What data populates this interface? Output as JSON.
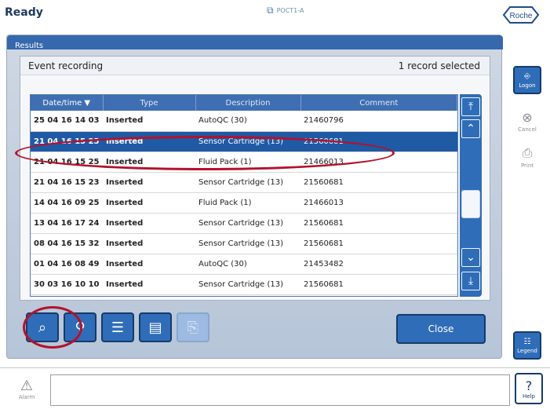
{
  "topbar": {
    "status": "Ready",
    "network_label": "POCT1-A",
    "brand": "Roche"
  },
  "dialog": {
    "title": "Results",
    "panel_title": "Event recording",
    "selected_count": "1 record selected"
  },
  "table": {
    "columns": [
      "Date/time",
      "Type",
      "Description",
      "Comment"
    ],
    "sorted_column": "Date/time",
    "rows": [
      {
        "datetime": "25 04 16 14 03",
        "type": "Inserted",
        "description": "AutoQC (30)",
        "comment": "21460796"
      },
      {
        "datetime": "21 04 16 15 25",
        "type": "Inserted",
        "description": "Sensor Cartridge (13)",
        "comment": "21560681",
        "selected": true
      },
      {
        "datetime": "21 04 16 15 25",
        "type": "Inserted",
        "description": "Fluid Pack (1)",
        "comment": "21466013"
      },
      {
        "datetime": "21 04 16 15 23",
        "type": "Inserted",
        "description": "Sensor Cartridge (13)",
        "comment": "21560681"
      },
      {
        "datetime": "14 04 16 09 25",
        "type": "Inserted",
        "description": "Fluid Pack (1)",
        "comment": "21466013"
      },
      {
        "datetime": "13 04 16 17 24",
        "type": "Inserted",
        "description": "Sensor Cartridge (13)",
        "comment": "21560681"
      },
      {
        "datetime": "08 04 16 15 32",
        "type": "Inserted",
        "description": "Sensor Cartridge (13)",
        "comment": "21560681"
      },
      {
        "datetime": "01 04 16 08 49",
        "type": "Inserted",
        "description": "AutoQC (30)",
        "comment": "21453482"
      },
      {
        "datetime": "30 03 16 10 10",
        "type": "Inserted",
        "description": "Sensor Cartridge (13)",
        "comment": "21560681"
      }
    ]
  },
  "toolbar": {
    "close_label": "Close"
  },
  "rail": {
    "logon": "Logon",
    "cancel": "Cancel",
    "print": "Print",
    "legend": "Legend",
    "help": "Help"
  },
  "bottom": {
    "alarm": "Alarm",
    "message": ""
  },
  "colors": {
    "accent": "#2f6db8",
    "header_blue": "#3f6fb2",
    "selected_row": "#1f5aa5",
    "highlight_red": "#b3122b"
  }
}
